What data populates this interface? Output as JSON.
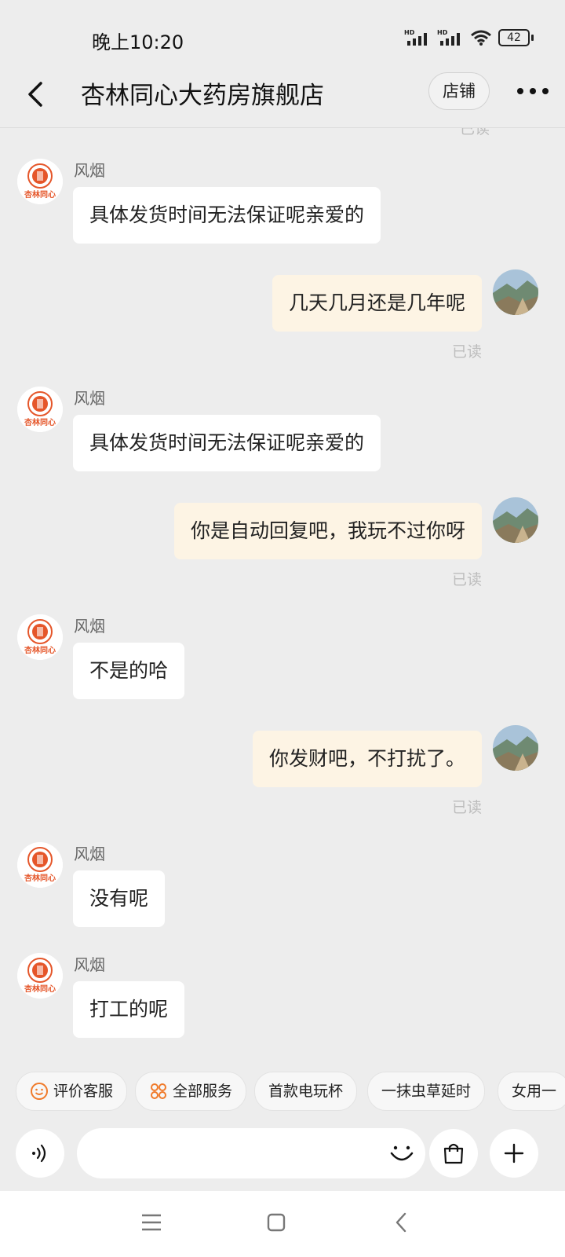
{
  "status_bar": {
    "time": "晚上10:20",
    "battery": "42",
    "hd1": "HD",
    "hd2": "HD"
  },
  "header": {
    "title": "杏林同心大药房旗舰店",
    "shop_label": "店铺"
  },
  "chat": {
    "partial_read": "已读",
    "messages": [
      {
        "from": "shop",
        "sender": "风烟",
        "text": "具体发货时间无法保证呢亲爱的"
      },
      {
        "from": "me",
        "text": "几天几月还是几年呢",
        "status": "已读"
      },
      {
        "from": "shop",
        "sender": "风烟",
        "text": "具体发货时间无法保证呢亲爱的"
      },
      {
        "from": "me",
        "text": "你是自动回复吧，我玩不过你呀",
        "status": "已读"
      },
      {
        "from": "shop",
        "sender": "风烟",
        "text": "不是的哈"
      },
      {
        "from": "me",
        "text": "你发财吧，不打扰了。",
        "status": "已读"
      },
      {
        "from": "shop",
        "sender": "风烟",
        "text": "没有呢"
      },
      {
        "from": "shop",
        "sender": "风烟",
        "text": "打工的呢"
      }
    ],
    "shop_avatar_text": "杏林同心"
  },
  "quick_actions": [
    {
      "label": "评价客服",
      "icon": "smile-icon"
    },
    {
      "label": "全部服务",
      "icon": "grid-icon"
    },
    {
      "label": "首款电玩杯",
      "icon": ""
    },
    {
      "label": "一抹虫草延时",
      "icon": ""
    },
    {
      "label": "女用一",
      "icon": ""
    }
  ],
  "input_bar": {
    "placeholder": "",
    "voice_icon": "voice-icon",
    "emoji_icon": "emoji-icon",
    "shop_icon": "shopping-bag-icon",
    "plus_icon": "plus-icon"
  },
  "colors": {
    "background": "#ededed",
    "incoming_bubble": "#ffffff",
    "outgoing_bubble": "#fdf4e4",
    "brand": "#e5562a",
    "chip_icon": "#f07a2a"
  }
}
